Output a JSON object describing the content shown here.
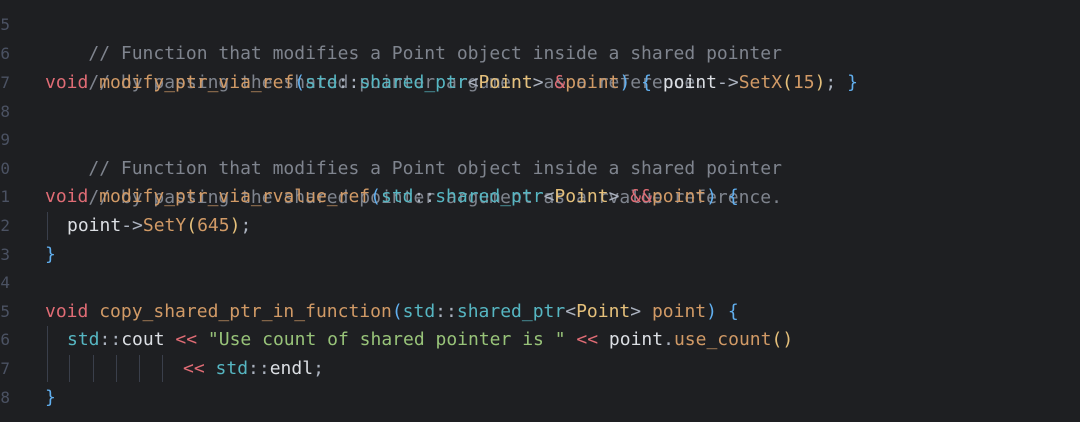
{
  "gutter": {
    "line_numbers": [
      "5",
      "6",
      "7",
      "8",
      "9",
      "0",
      "1",
      "2",
      "3",
      "4",
      "5",
      "6",
      "7",
      "8"
    ]
  },
  "code": {
    "l1_comment": "// Function that modifies a Point object inside a shared pointer",
    "l2_comment": "// by passing the shared pointer argument as a reference.",
    "l3_kw": "void",
    "l3_fn": "modify_ptr_via_ref",
    "l3_p1": "(",
    "l3_ns": "std",
    "l3_sep": "::",
    "l3_type": "shared_ptr",
    "l3_lt": "<",
    "l3_cls": "Point",
    "l3_gt": ">",
    "l3_amp": " &",
    "l3_arg": "point",
    "l3_p2": ")",
    "l3_ob": " { ",
    "l3_obj": "point",
    "l3_arrow": "->",
    "l3_call": "SetX",
    "l3_cp1": "(",
    "l3_num": "15",
    "l3_cp2": ")",
    "l3_semi": "; ",
    "l3_cb": "}",
    "l5_comment": "// Function that modifies a Point object inside a shared pointer",
    "l6_comment": "// by passing the shared pointer argument as a rvalue reference.",
    "l7_kw": "void",
    "l7_fn": "modify_ptr_via_rvalue_ref",
    "l7_p1": "(",
    "l7_ns": "std",
    "l7_sep": "::",
    "l7_type": "shared_ptr",
    "l7_lt": "<",
    "l7_cls": "Point",
    "l7_gt": ">",
    "l7_amp": " &&",
    "l7_arg": "point",
    "l7_p2": ")",
    "l7_ob": " {",
    "l8_obj": "point",
    "l8_arrow": "->",
    "l8_call": "SetY",
    "l8_cp1": "(",
    "l8_num": "645",
    "l8_cp2": ")",
    "l8_semi": ";",
    "l9_cb": "}",
    "l11_kw": "void",
    "l11_fn": "copy_shared_ptr_in_function",
    "l11_p1": "(",
    "l11_ns": "std",
    "l11_sep": "::",
    "l11_type": "shared_ptr",
    "l11_lt": "<",
    "l11_cls": "Point",
    "l11_gt": ">",
    "l11_arg": " point",
    "l11_p2": ")",
    "l11_ob": " {",
    "l12_ns": "std",
    "l12_sep": "::",
    "l12_cout": "cout",
    "l12_op1": " << ",
    "l12_str": "\"Use count of shared pointer is \"",
    "l12_op2": " << ",
    "l12_obj": "point",
    "l12_dot": ".",
    "l12_call": "use_count",
    "l12_cp": "()",
    "l13_op": "<< ",
    "l13_ns": "std",
    "l13_sep": "::",
    "l13_endl": "endl",
    "l13_semi": ";",
    "l14_cb": "}"
  },
  "colors": {
    "background": "#1e1f22",
    "comment": "#7f848e",
    "keyword": "#e06c75",
    "function_name": "#d19a66",
    "namespace": "#56b6c2",
    "type": "#61afef",
    "class": "#e5c07b",
    "string": "#98c379",
    "number": "#d19a66"
  }
}
